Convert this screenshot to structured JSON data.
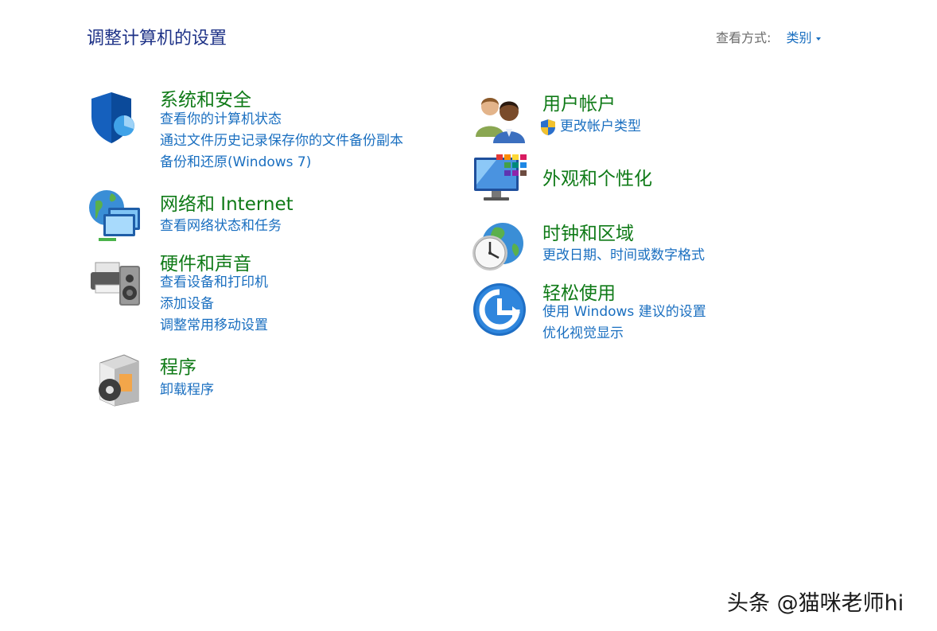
{
  "page_title": "调整计算机的设置",
  "view_by": {
    "label": "查看方式:",
    "value": "类别"
  },
  "categories": {
    "security": {
      "title": "系统和安全",
      "links": [
        "查看你的计算机状态",
        "通过文件历史记录保存你的文件备份副本",
        "备份和还原(Windows 7)"
      ],
      "icon": "shield-icon"
    },
    "network": {
      "title": "网络和 Internet",
      "links": [
        "查看网络状态和任务"
      ],
      "icon": "network-globe-icon"
    },
    "hardware": {
      "title": "硬件和声音",
      "links": [
        "查看设备和打印机",
        "添加设备",
        "调整常用移动设置"
      ],
      "icon": "printer-speaker-icon"
    },
    "programs": {
      "title": "程序",
      "links": [
        "卸载程序"
      ],
      "icon": "programs-box-icon"
    },
    "accounts": {
      "title": "用户帐户",
      "links": [
        "更改帐户类型"
      ],
      "icon": "users-icon",
      "link_icon": "uac-shield-icon"
    },
    "appearance": {
      "title": "外观和个性化",
      "links": [],
      "icon": "monitor-palette-icon"
    },
    "clock": {
      "title": "时钟和区域",
      "links": [
        "更改日期、时间或数字格式"
      ],
      "icon": "globe-clock-icon"
    },
    "ease": {
      "title": "轻松使用",
      "links": [
        "使用 Windows 建议的设置",
        "优化视觉显示"
      ],
      "icon": "ease-of-access-icon"
    }
  },
  "watermark": "头条 @猫咪老师hi",
  "colors": {
    "title": "#1e3287",
    "category": "#0f7a17",
    "link": "#1a6fc0",
    "label": "#6b6b6b"
  }
}
